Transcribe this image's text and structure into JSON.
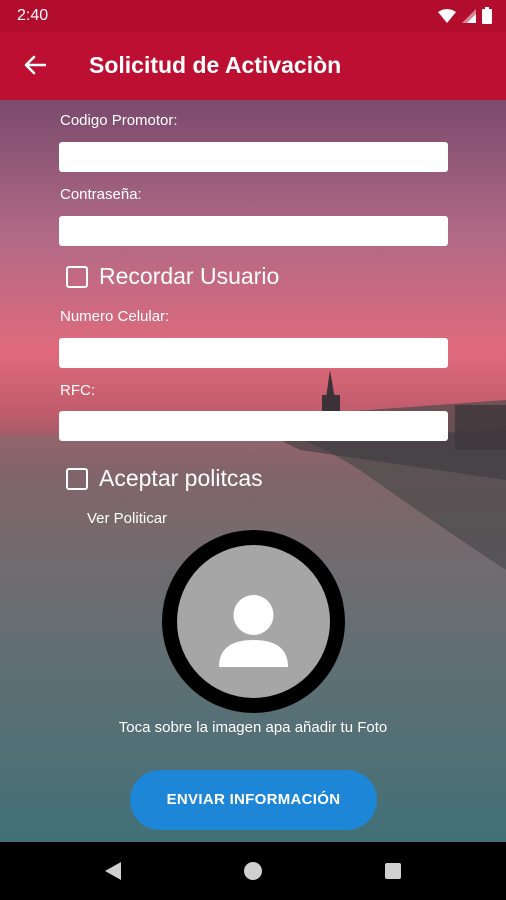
{
  "status_bar": {
    "time": "2:40",
    "icons": [
      "wifi-icon",
      "signal-icon",
      "battery-icon"
    ]
  },
  "app_bar": {
    "title": "Solicitud de Activaciòn",
    "back_icon": "arrow-back-icon",
    "color": "#bd0f32"
  },
  "form": {
    "promoter_code_label": "Codigo Promotor:",
    "promoter_code_value": "",
    "password_label": "Contraseña:",
    "password_value": "",
    "remember_user_label": "Recordar Usuario",
    "remember_user_checked": false,
    "phone_label": "Numero Celular:",
    "phone_value": "",
    "rfc_label": "RFC:",
    "rfc_value": "",
    "accept_policies_label": "Aceptar politcas",
    "accept_policies_checked": false,
    "view_policies_link": "Ver Politicar"
  },
  "photo": {
    "hint": "Toca sobre la imagen apa añadir tu Foto",
    "icon": "person-placeholder-icon"
  },
  "submit_button": {
    "label": "ENVIAR INFORMACIÓN",
    "color": "#1e86d6"
  },
  "nav_bar": {
    "icons": [
      "back-triangle-icon",
      "home-circle-icon",
      "recents-square-icon"
    ]
  }
}
